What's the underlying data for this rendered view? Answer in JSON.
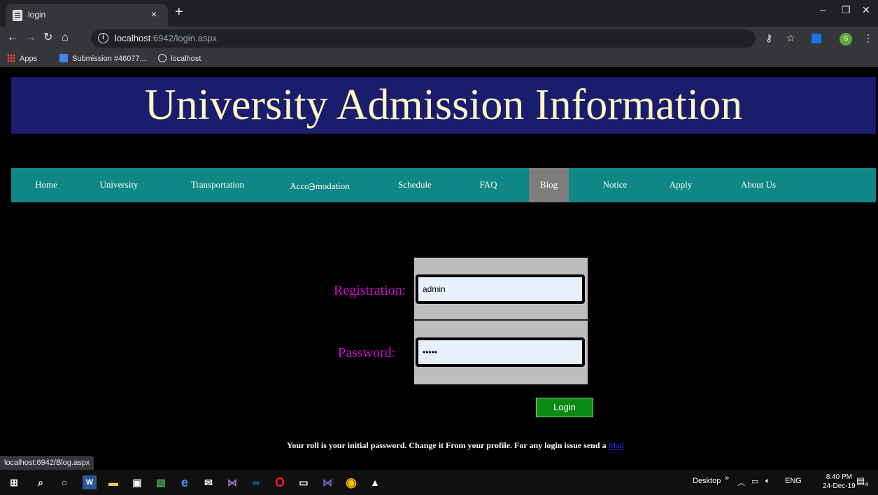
{
  "browser": {
    "tab_title": "login",
    "tab_close": "×",
    "new_tab": "+",
    "window": {
      "minimize": "–",
      "maximize": "❐",
      "close": "✕"
    },
    "url_host": "localhost",
    "url_path": ":6942/login.aspx",
    "bookmarks": [
      {
        "label": "Apps"
      },
      {
        "label": "Submission #46077..."
      },
      {
        "label": "localhost"
      }
    ],
    "profile_initial": "S",
    "status_url": "localhost:6942/Blog.aspx"
  },
  "page": {
    "banner_title": "University Admission Information",
    "nav": [
      {
        "label": "Home",
        "active": false
      },
      {
        "label": "University",
        "active": false
      },
      {
        "label": "Transportation",
        "active": false
      },
      {
        "label": "Acco℈modation",
        "active": false
      },
      {
        "label": "Schedule",
        "active": false
      },
      {
        "label": "FAQ",
        "active": false
      },
      {
        "label": "Blog",
        "active": true
      },
      {
        "label": "Notice",
        "active": false
      },
      {
        "label": "Apply",
        "active": false
      },
      {
        "label": "About Us",
        "active": false
      }
    ],
    "form": {
      "registration_label": "Registration:",
      "registration_value": "admin",
      "password_label": "Password:",
      "password_value": "•••••",
      "login_label": "Login"
    },
    "footnote_text": "Your roll is your initial password. Change it From your profile. For any login issue send a ",
    "footnote_link": "Mail"
  },
  "taskbar": {
    "tray_desktop": "Desktop",
    "tray_chevron": "»",
    "tray_lang": "ENG",
    "time": "8:40 PM",
    "date": "24-Dec-19",
    "notification_count": "4"
  },
  "colors": {
    "banner_bg": "#1a1d6e",
    "banner_text": "#fdf6c3",
    "nav_bg": "#0f8786",
    "nav_active": "#7d7d7d",
    "label_magenta": "#d010d0",
    "login_green": "#0a8a12"
  }
}
